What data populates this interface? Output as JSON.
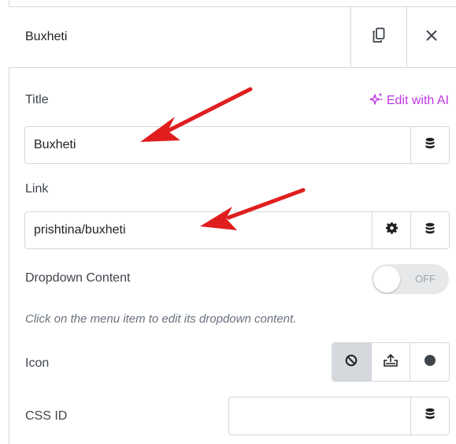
{
  "header": {
    "title": "Buxheti",
    "duplicate_icon": "copy-icon",
    "close_icon": "close-icon"
  },
  "title_field": {
    "label": "Title",
    "ai_label": "Edit with AI",
    "ai_icon": "sparkle-icon",
    "value": "Buxheti",
    "dynamic_icon": "database-icon"
  },
  "link_field": {
    "label": "Link",
    "value": "prishtina/buxheti",
    "settings_icon": "gear-icon",
    "dynamic_icon": "database-icon"
  },
  "dropdown": {
    "label": "Dropdown Content",
    "toggle_text": "OFF",
    "help": "Click on the menu item to edit its dropdown content."
  },
  "icon_field": {
    "label": "Icon",
    "options": [
      "none-icon",
      "upload-icon",
      "circle-icon"
    ],
    "selected": "none-icon"
  },
  "css_id_field": {
    "label": "CSS ID",
    "value": "",
    "dynamic_icon": "database-icon"
  },
  "colors": {
    "accent_ai": "#c036e2",
    "annotation_arrow": "#e01e1e",
    "border": "#d5d8dc"
  }
}
